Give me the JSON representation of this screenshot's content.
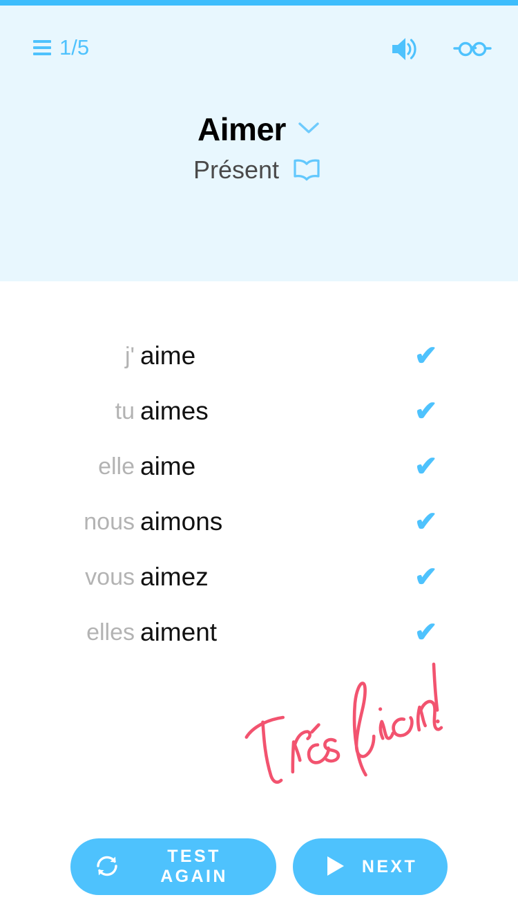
{
  "app": {
    "accent_color": "#3dbdfc",
    "header_bg": "#e8f7fe",
    "icon_blue": "#4ec2fd",
    "praise_pink": "#f2536f",
    "pronoun_gray": "#b3b3b3"
  },
  "header": {
    "menu_icon": "hamburger-icon",
    "progress": "1/5",
    "audio_icon": "speaker-icon",
    "reader_icon": "glasses-icon"
  },
  "verb": {
    "infinitive": "Aimer",
    "dropdown_icon": "chevron-down-icon",
    "tense": "Présent",
    "tense_icon": "book-icon"
  },
  "conjugation": {
    "rows": [
      {
        "pronoun": "j'",
        "form": "aime",
        "status": "correct",
        "status_icon": "check-icon"
      },
      {
        "pronoun": "tu",
        "form": "aimes",
        "status": "correct",
        "status_icon": "check-icon"
      },
      {
        "pronoun": "elle",
        "form": "aime",
        "status": "correct",
        "status_icon": "check-icon"
      },
      {
        "pronoun": "nous",
        "form": "aimons",
        "status": "correct",
        "status_icon": "check-icon"
      },
      {
        "pronoun": "vous",
        "form": "aimez",
        "status": "correct",
        "status_icon": "check-icon"
      },
      {
        "pronoun": "elles",
        "form": "aiment",
        "status": "correct",
        "status_icon": "check-icon"
      }
    ],
    "check_glyph": "✔"
  },
  "feedback": {
    "message": "Très bien!",
    "style": "handwritten-script",
    "color": "#f2536f"
  },
  "actions": {
    "test_again": {
      "label": "TEST AGAIN",
      "icon": "refresh-icon"
    },
    "next": {
      "label": "NEXT",
      "icon": "play-icon"
    }
  }
}
